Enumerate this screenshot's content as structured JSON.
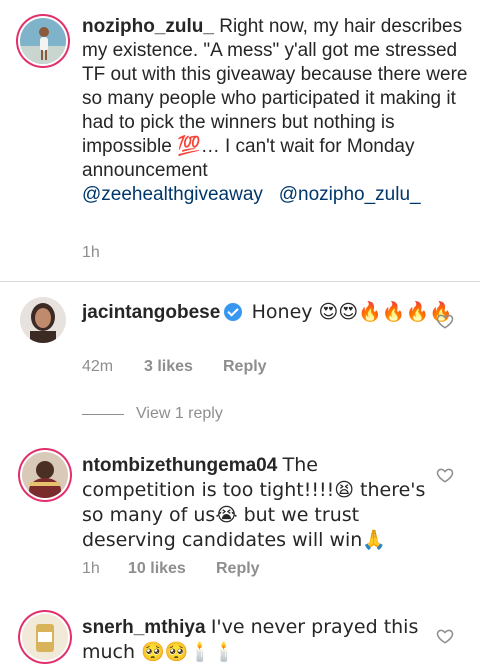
{
  "caption": {
    "username": "nozipho_zulu_",
    "text": "Right now, my hair describes my existence. \"A mess\" y'all got me stressed TF out with this giveaway because there were so many people who participated it making it had to pick the winners but nothing is impossible 💯… I can't wait for Monday announcement",
    "mention1": "@zeehealthgiveaway",
    "mention2": "@nozipho_zulu_",
    "time": "1h"
  },
  "comments": [
    {
      "username": "jacintangobese",
      "text": "Honey 😍😍🔥🔥🔥🔥",
      "time": "42m",
      "likes": "3 likes",
      "reply": "Reply",
      "view_replies": "View 1 reply"
    },
    {
      "username": "ntombizethungema04",
      "text": "The competition is too tight!!!!😫 there's so many of us😭 but we trust deserving candidates will win🙏",
      "time": "1h",
      "likes": "10 likes",
      "reply": "Reply"
    },
    {
      "username": "snerh_mthiya",
      "text": "I've never prayed this much 🥺🥺🕯️🕯️"
    }
  ],
  "icons": {
    "heart": "heart-outline-icon",
    "verified": "verified-badge-icon"
  },
  "colors": {
    "text": "#262626",
    "secondary": "#8e8e8e",
    "mention": "#00376b",
    "verified": "#3897f0"
  }
}
